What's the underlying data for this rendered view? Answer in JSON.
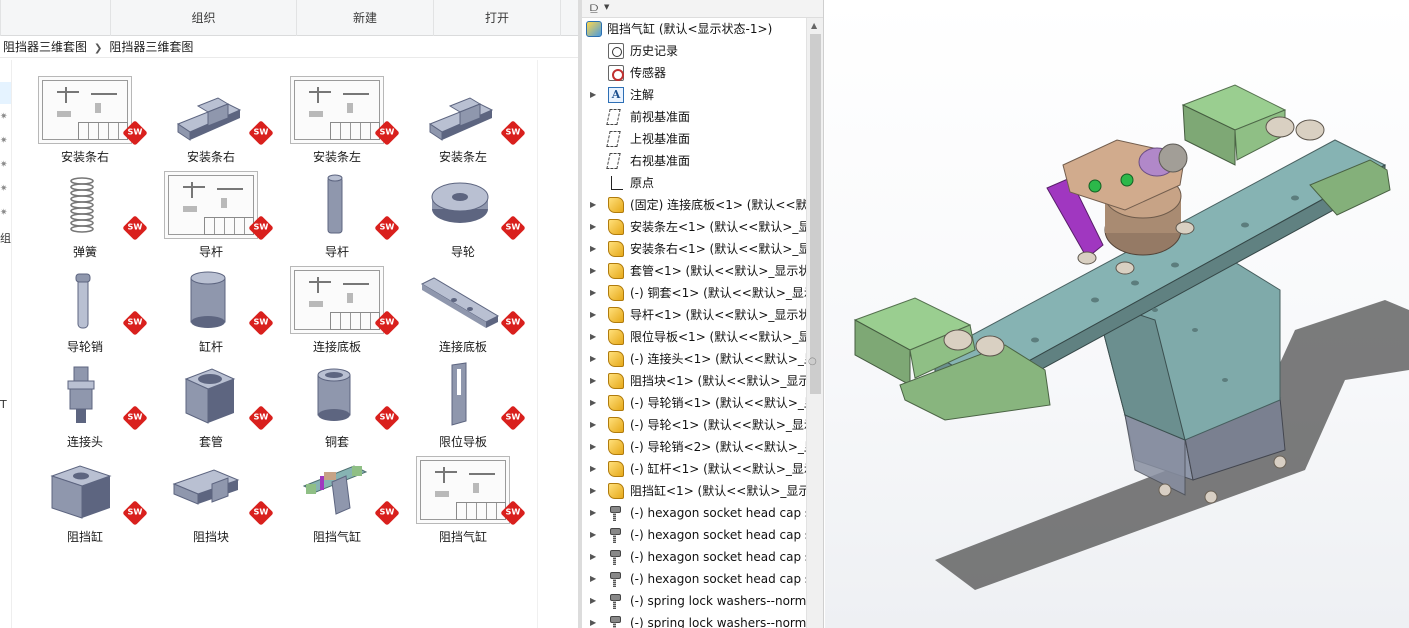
{
  "ribbon": {
    "groups": [
      "组织",
      "新建",
      "打开"
    ]
  },
  "breadcrumb": {
    "items": [
      "阻挡器三维套图",
      "阻挡器三维套图"
    ]
  },
  "nav": {
    "fragments": [
      "组",
      "T"
    ]
  },
  "files": [
    {
      "label": "安装条右",
      "kind": "drawing",
      "icon": "drawing-thumbnail"
    },
    {
      "label": "安装条右",
      "kind": "part",
      "icon": "bracket-part-thumbnail"
    },
    {
      "label": "安装条左",
      "kind": "drawing",
      "icon": "drawing-thumbnail"
    },
    {
      "label": "安装条左",
      "kind": "part",
      "icon": "bracket-part-thumbnail"
    },
    {
      "label": "弹簧",
      "kind": "part",
      "icon": "spring-thumbnail"
    },
    {
      "label": "导杆",
      "kind": "drawing",
      "icon": "drawing-thumbnail"
    },
    {
      "label": "导杆",
      "kind": "part",
      "icon": "rod-thumbnail"
    },
    {
      "label": "导轮",
      "kind": "part",
      "icon": "wheel-thumbnail"
    },
    {
      "label": "导轮销",
      "kind": "part",
      "icon": "pin-thumbnail"
    },
    {
      "label": "缸杆",
      "kind": "part",
      "icon": "cylinder-rod-thumbnail"
    },
    {
      "label": "连接底板",
      "kind": "drawing",
      "icon": "drawing-thumbnail"
    },
    {
      "label": "连接底板",
      "kind": "part",
      "icon": "plate-thumbnail"
    },
    {
      "label": "连接头",
      "kind": "part",
      "icon": "connector-thumbnail"
    },
    {
      "label": "套管",
      "kind": "part",
      "icon": "sleeve-block-thumbnail"
    },
    {
      "label": "铜套",
      "kind": "part",
      "icon": "bushing-thumbnail"
    },
    {
      "label": "限位导板",
      "kind": "part",
      "icon": "guide-plate-thumbnail"
    },
    {
      "label": "阻挡缸",
      "kind": "part",
      "icon": "block-thumbnail"
    },
    {
      "label": "阻挡块",
      "kind": "part",
      "icon": "stopper-block-thumbnail"
    },
    {
      "label": "阻挡气缸",
      "kind": "assembly",
      "icon": "assembly-thumbnail"
    },
    {
      "label": "阻挡气缸",
      "kind": "drawing",
      "icon": "drawing-thumbnail"
    }
  ],
  "badge": {
    "text": "SW",
    "color": "#d9201d"
  },
  "tree": {
    "items": [
      {
        "text": "阻挡气缸 (默认<显示状态-1>)",
        "icon": "assembly-icon",
        "level": 0,
        "expander": false
      },
      {
        "text": "历史记录",
        "icon": "history-icon",
        "level": 1,
        "expander": false
      },
      {
        "text": "传感器",
        "icon": "sensor-icon",
        "level": 1,
        "expander": false
      },
      {
        "text": "注解",
        "icon": "annotation-icon",
        "level": 1,
        "expander": true
      },
      {
        "text": "前视基准面",
        "icon": "plane-icon",
        "level": 1,
        "expander": false
      },
      {
        "text": "上视基准面",
        "icon": "plane-icon",
        "level": 1,
        "expander": false
      },
      {
        "text": "右视基准面",
        "icon": "plane-icon",
        "level": 1,
        "expander": false
      },
      {
        "text": "原点",
        "icon": "origin-icon",
        "level": 1,
        "expander": false
      },
      {
        "text": "(固定) 连接底板<1> (默认<<默认",
        "icon": "part-icon",
        "level": 1,
        "expander": true
      },
      {
        "text": "安装条左<1> (默认<<默认>_显",
        "icon": "part-icon",
        "level": 1,
        "expander": true
      },
      {
        "text": "安装条右<1> (默认<<默认>_显",
        "icon": "part-icon",
        "level": 1,
        "expander": true
      },
      {
        "text": "套管<1> (默认<<默认>_显示状",
        "icon": "part-icon",
        "level": 1,
        "expander": true
      },
      {
        "text": "(-) 铜套<1> (默认<<默认>_显示",
        "icon": "part-icon",
        "level": 1,
        "expander": true
      },
      {
        "text": "导杆<1> (默认<<默认>_显示状",
        "icon": "part-icon",
        "level": 1,
        "expander": true
      },
      {
        "text": "限位导板<1> (默认<<默认>_显",
        "icon": "part-icon",
        "level": 1,
        "expander": true
      },
      {
        "text": "(-) 连接头<1> (默认<<默认>_显",
        "icon": "part-icon",
        "level": 1,
        "expander": true
      },
      {
        "text": "阻挡块<1> (默认<<默认>_显示",
        "icon": "part-icon",
        "level": 1,
        "expander": true
      },
      {
        "text": "(-) 导轮销<1> (默认<<默认>_显",
        "icon": "part-icon",
        "level": 1,
        "expander": true
      },
      {
        "text": "(-) 导轮<1> (默认<<默认>_显示",
        "icon": "part-icon",
        "level": 1,
        "expander": true
      },
      {
        "text": "(-) 导轮销<2> (默认<<默认>_显",
        "icon": "part-icon",
        "level": 1,
        "expander": true
      },
      {
        "text": "(-) 缸杆<1> (默认<<默认>_显示",
        "icon": "part-icon",
        "level": 1,
        "expander": true
      },
      {
        "text": "阻挡缸<1> (默认<<默认>_显示",
        "icon": "part-icon",
        "level": 1,
        "expander": true
      },
      {
        "text": "(-) hexagon socket head cap s",
        "icon": "screw-icon",
        "level": 1,
        "expander": true
      },
      {
        "text": "(-) hexagon socket head cap s",
        "icon": "screw-icon",
        "level": 1,
        "expander": true
      },
      {
        "text": "(-) hexagon socket head cap s",
        "icon": "screw-icon",
        "level": 1,
        "expander": true
      },
      {
        "text": "(-) hexagon socket head cap s",
        "icon": "screw-icon",
        "level": 1,
        "expander": true
      },
      {
        "text": "(-) spring lock washers--norm",
        "icon": "washer-icon",
        "level": 1,
        "expander": true
      },
      {
        "text": "(-) spring lock washers--norm",
        "icon": "washer-icon",
        "level": 1,
        "expander": true
      }
    ]
  },
  "viewport": {
    "colors": {
      "plate": "#86b3b3",
      "bracket": "#8fbf85",
      "block": "#8f97a9",
      "head": "#c7a386",
      "guide": "#a037c0",
      "shadow": "#4a4a4a"
    }
  }
}
